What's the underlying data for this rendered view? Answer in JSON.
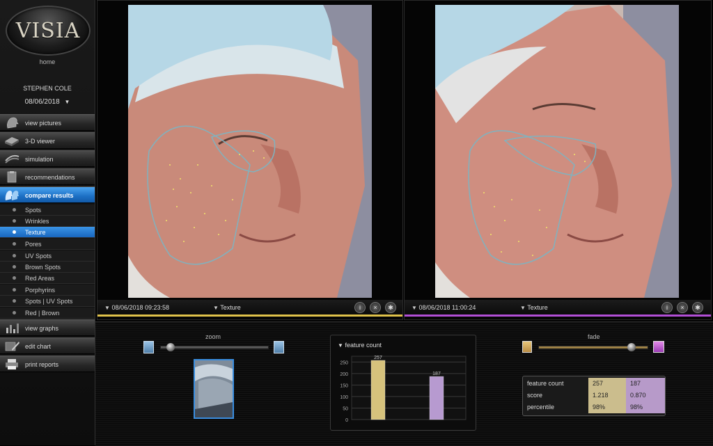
{
  "app": {
    "logo_text": "VISIA",
    "home_label": "home"
  },
  "patient": {
    "name": "STEPHEN COLE",
    "date": "08/06/2018"
  },
  "nav": [
    {
      "label": "view pictures",
      "icon": "face-profile-icon"
    },
    {
      "label": "3-D viewer",
      "icon": "3d-model-icon"
    },
    {
      "label": "simulation",
      "icon": "simulation-icon"
    },
    {
      "label": "recommendations",
      "icon": "clipboard-icon"
    },
    {
      "label": "compare results",
      "icon": "compare-faces-icon",
      "active": true
    }
  ],
  "subnav": [
    {
      "label": "Spots"
    },
    {
      "label": "Wrinkles"
    },
    {
      "label": "Texture",
      "active": true
    },
    {
      "label": "Pores"
    },
    {
      "label": "UV Spots"
    },
    {
      "label": "Brown Spots"
    },
    {
      "label": "Red Areas"
    },
    {
      "label": "Porphyrins"
    },
    {
      "label": "Spots | UV Spots"
    },
    {
      "label": "Red | Brown"
    }
  ],
  "nav_bottom": [
    {
      "label": "view graphs",
      "icon": "graph-icon"
    },
    {
      "label": "edit chart",
      "icon": "edit-chart-icon"
    },
    {
      "label": "print reports",
      "icon": "printer-icon"
    }
  ],
  "left_image": {
    "timestamp": "08/06/2018 09:23:58",
    "mode": "Texture",
    "accent": "#e0c24a"
  },
  "right_image": {
    "timestamp": "08/06/2018 11:00:24",
    "mode": "Texture",
    "accent": "#b24fd6"
  },
  "zoom": {
    "label": "zoom",
    "level": 0.1
  },
  "fade": {
    "label": "fade",
    "level": 0.86
  },
  "feature_count_panel": {
    "title": "feature count",
    "chart_data": {
      "type": "bar",
      "categories": [
        "08/06/2018 09:23:58",
        "08/06/2018 11:00:24"
      ],
      "values": [
        257,
        187
      ],
      "ylim": [
        0,
        275
      ],
      "yticks": [
        0,
        50,
        100,
        150,
        200,
        250
      ],
      "colors": [
        "#d6c27c",
        "#b79ad0"
      ],
      "grid": true
    }
  },
  "stats": [
    {
      "label": "feature count",
      "left": "257",
      "right": "187"
    },
    {
      "label": "score",
      "left": "1.218",
      "right": "0.870"
    },
    {
      "label": "percentile",
      "left": "98%",
      "right": "98%"
    }
  ]
}
